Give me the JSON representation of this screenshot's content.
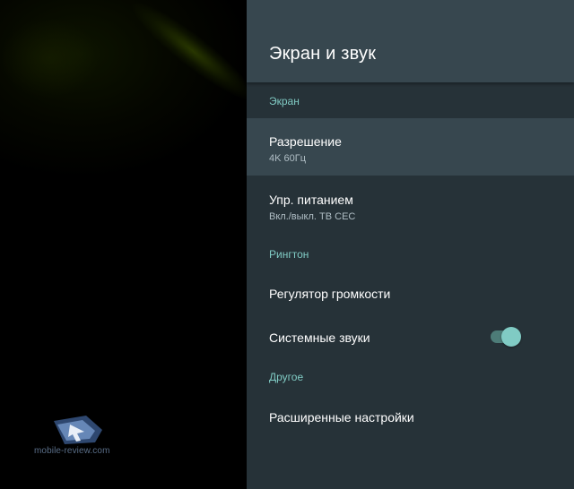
{
  "header": {
    "title": "Экран и звук"
  },
  "sections": {
    "screen": "Экран",
    "ringtone": "Рингтон",
    "other": "Другое"
  },
  "items": {
    "resolution": {
      "title": "Разрешение",
      "subtitle": "4K 60Гц"
    },
    "power": {
      "title": "Упр. питанием",
      "subtitle": "Вкл./выкл. ТВ CEC"
    },
    "volume": {
      "title": "Регулятор громкости"
    },
    "system_sounds": {
      "title": "Системные звуки",
      "toggle_on": true
    },
    "advanced": {
      "title": "Расширенные настройки"
    }
  },
  "watermark": {
    "text": "mobile-review.com"
  },
  "colors": {
    "panel_bg": "#263238",
    "header_bg": "#37474f",
    "accent": "#80cbc4",
    "selected_bg": "#37474f"
  }
}
